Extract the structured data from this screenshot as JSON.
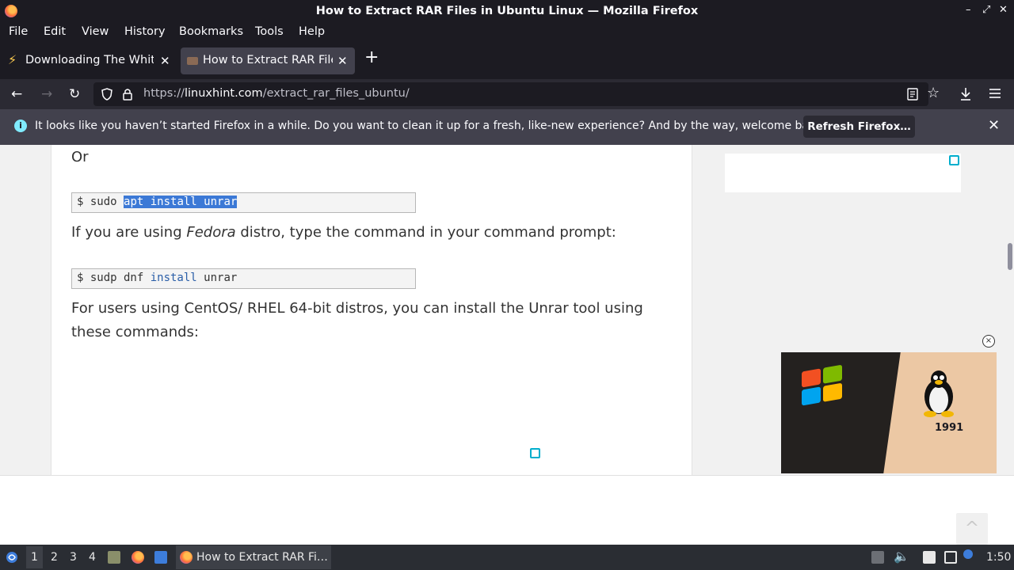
{
  "window": {
    "title": "How to Extract RAR Files in Ubuntu Linux — Mozilla Firefox",
    "controls": [
      "–",
      "⤢",
      "✕"
    ]
  },
  "menu": {
    "items": [
      "File",
      "Edit",
      "View",
      "History",
      "Bookmarks",
      "Tools",
      "Help"
    ]
  },
  "tabs": [
    {
      "label": "Downloading The White | ",
      "close": "✕",
      "icon": "lightning-icon"
    },
    {
      "label": "How to Extract RAR Files",
      "close": "✕",
      "icon": "site-favicon"
    }
  ],
  "new_tab": "+",
  "nav": {
    "back": "←",
    "forward": "→",
    "reload": "↻",
    "url_scheme": "https://",
    "url_domain": "linuxhint.com",
    "url_path": "/extract_rar_files_ubuntu/"
  },
  "notification": {
    "icon": "i",
    "message": "It looks like you haven’t started Firefox in a while. Do you want to clean it up for a fresh, like-new experience? And by the way, welcome back!",
    "button": "Refresh Firefox…",
    "close": "✕"
  },
  "article": {
    "or_text": "Or",
    "code1": {
      "prompt": "$ sudo ",
      "selected": "apt install unrar"
    },
    "para1_pre": "If you are using ",
    "para1_em": "Fedora",
    "para1_post": " distro, type the command in your command prompt:",
    "code2": {
      "prompt": "$ sudp dnf ",
      "kw": "install",
      "rest": " unrar"
    },
    "para2": "For users using CentOS/ RHEL 64-bit distros, you can install the Unrar tool using these commands:"
  },
  "video": {
    "year": "1991",
    "close": "×"
  },
  "scroll_top": "^",
  "taskbar": {
    "workspaces": [
      "1",
      "2",
      "3",
      "4"
    ],
    "active_task": "How to Extract RAR Fi…",
    "clock": "1:50"
  },
  "colors": {
    "accent": "#3c79d6",
    "dark": "#1c1b22",
    "ad_icon": "#00aecd"
  }
}
